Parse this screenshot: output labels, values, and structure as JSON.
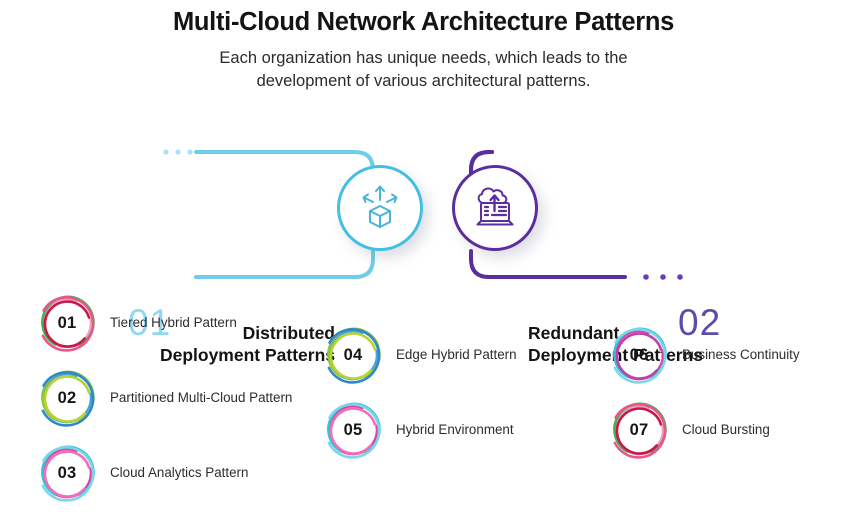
{
  "header": {
    "title": "Multi-Cloud Network Architecture Patterns",
    "subtitle_line1": "Each organization has unique needs, which leads to the",
    "subtitle_line2": "development of various architectural patterns."
  },
  "colors": {
    "cyan": "#43bfe3",
    "cyan_light": "#8fd8f2",
    "purple": "#5b2d9e",
    "purple_light": "#5b4bab",
    "text_dark": "#141414"
  },
  "hero": {
    "nodes": [
      {
        "number": "01",
        "label_line1": "Distributed",
        "label_line2": "Deployment Patterns",
        "icon": "distributed-cube-arrows-icon",
        "accent": "#43bfe3"
      },
      {
        "number": "02",
        "label_line1": "Redundant",
        "label_line2": "Deployment Patterns",
        "icon": "laptop-cloud-upload-icon",
        "accent": "#5b2d9e"
      }
    ]
  },
  "items": {
    "column1": [
      {
        "number": "01",
        "label": "Tiered Hybrid Pattern",
        "ring_colors": [
          "#f2a0c0",
          "#3fb54a",
          "#c8174a",
          "#e8568c"
        ]
      },
      {
        "number": "02",
        "label": "Partitioned Multi-Cloud Pattern",
        "ring_colors": [
          "#4aa3dd",
          "#8cc63f",
          "#b9d330",
          "#2f89c8"
        ]
      },
      {
        "number": "03",
        "label": "Cloud Analytics Pattern",
        "ring_colors": [
          "#e040a8",
          "#2fc5d8",
          "#f06fb8",
          "#7ad6e8"
        ]
      }
    ],
    "column2": [
      {
        "number": "04",
        "label": "Edge Hybrid Pattern",
        "ring_colors": [
          "#4aa3dd",
          "#8cc63f",
          "#b9d330",
          "#2f89c8"
        ]
      },
      {
        "number": "05",
        "label": "Hybrid Environment",
        "ring_colors": [
          "#e040a8",
          "#2fc5d8",
          "#f06fb8",
          "#7ad6e8"
        ]
      }
    ],
    "column3": [
      {
        "number": "06",
        "label": "Business Continuity",
        "ring_colors": [
          "#e040a8",
          "#2fc5d8",
          "#c13fa8",
          "#7ad6e8"
        ]
      },
      {
        "number": "07",
        "label": "Cloud Bursting",
        "ring_colors": [
          "#f2a0c0",
          "#3fb54a",
          "#c8174a",
          "#e8568c"
        ]
      }
    ]
  }
}
